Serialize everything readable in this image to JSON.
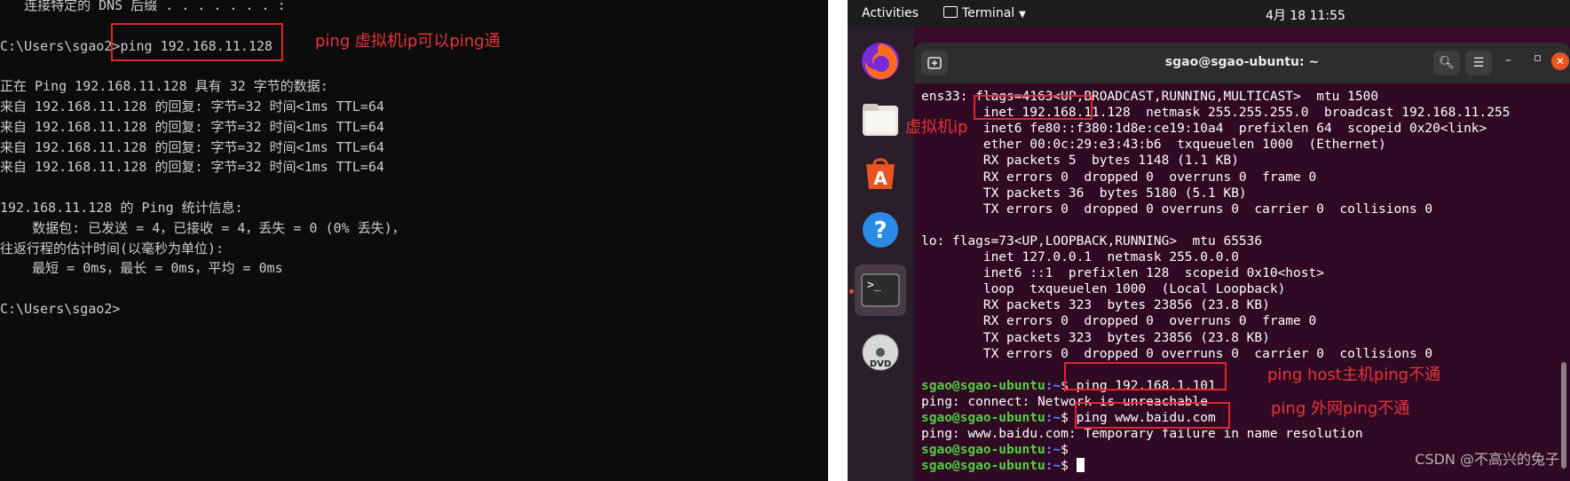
{
  "cmd": {
    "lines": [
      "   连接特定的 DNS 后缀 . . . . . . . :",
      "",
      "C:\\Users\\sgao2>ping 192.168.11.128",
      "",
      "正在 Ping 192.168.11.128 具有 32 字节的数据:",
      "来自 192.168.11.128 的回复: 字节=32 时间<1ms TTL=64",
      "来自 192.168.11.128 的回复: 字节=32 时间<1ms TTL=64",
      "来自 192.168.11.128 的回复: 字节=32 时间<1ms TTL=64",
      "来自 192.168.11.128 的回复: 字节=32 时间<1ms TTL=64",
      "",
      "192.168.11.128 的 Ping 统计信息:",
      "    数据包: 已发送 = 4，已接收 = 4，丢失 = 0 (0% 丢失)，",
      "往返行程的估计时间(以毫秒为单位):",
      "    最短 = 0ms，最长 = 0ms，平均 = 0ms",
      "",
      "C:\\Users\\sgao2>"
    ],
    "annotation": "ping 虚拟机ip可以ping通"
  },
  "ubuntu": {
    "topbar": {
      "activities": "Activities",
      "app_label": "Terminal",
      "clock": "4月 18 11:55"
    },
    "dock": {
      "items": [
        "firefox-icon",
        "files-icon",
        "software-icon",
        "help-icon",
        "terminal-icon",
        "dvd-icon"
      ]
    },
    "terminal": {
      "title": "sgao@sgao-ubuntu: ~",
      "output": [
        "ens33: flags=4163<UP,BROADCAST,RUNNING,MULTICAST>  mtu 1500",
        "        inet 192.168.11.128  netmask 255.255.255.0  broadcast 192.168.11.255",
        "        inet6 fe80::f380:1d8e:ce19:10a4  prefixlen 64  scopeid 0x20<link>",
        "        ether 00:0c:29:e3:43:b6  txqueuelen 1000  (Ethernet)",
        "        RX packets 5  bytes 1148 (1.1 KB)",
        "        RX errors 0  dropped 0  overruns 0  frame 0",
        "        TX packets 36  bytes 5180 (5.1 KB)",
        "        TX errors 0  dropped 0 overruns 0  carrier 0  collisions 0",
        "",
        "lo: flags=73<UP,LOOPBACK,RUNNING>  mtu 65536",
        "        inet 127.0.0.1  netmask 255.0.0.0",
        "        inet6 ::1  prefixlen 128  scopeid 0x10<host>",
        "        loop  txqueuelen 1000  (Local Loopback)",
        "        RX packets 323  bytes 23856 (23.8 KB)",
        "        RX errors 0  dropped 0  overruns 0  frame 0",
        "        TX packets 323  bytes 23856 (23.8 KB)",
        "        TX errors 0  dropped 0 overruns 0  carrier 0  collisions 0",
        ""
      ],
      "prompt_user": "sgao@sgao-ubuntu",
      "prompt_path": ":~",
      "prompt_symbol": "$ ",
      "cmd1": "ping 192.168.1.101",
      "out1": "ping: connect: Network is unreachable",
      "cmd2": "ping www.baidu.com",
      "out2": "ping: www.baidu.com: Temporary failure in name resolution"
    },
    "annotations": {
      "vm_ip": "虚拟机ip",
      "host": "ping host主机ping不通",
      "external": "ping 外网ping不通"
    },
    "watermark": "CSDN @不高兴的兔子"
  }
}
